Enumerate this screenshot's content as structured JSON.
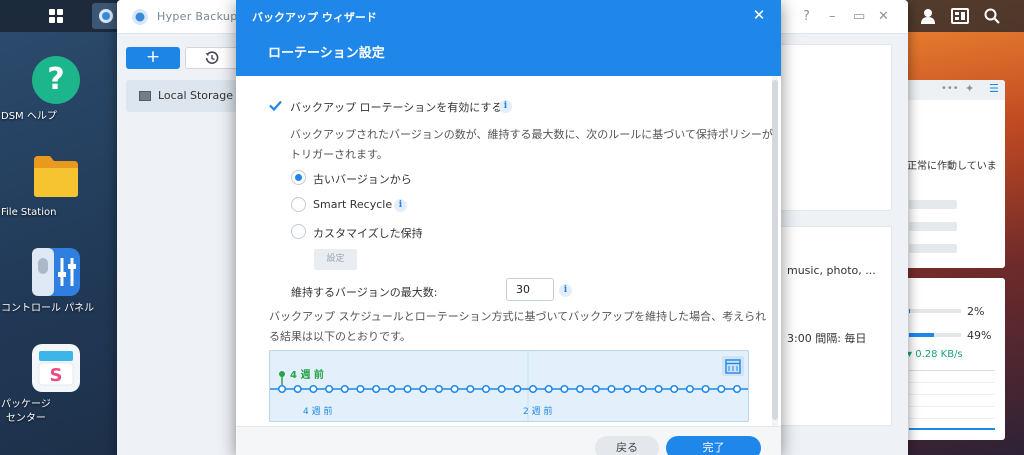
{
  "desktop": {
    "icons": [
      {
        "name": "dsm-help",
        "label": "DSM ヘルプ"
      },
      {
        "name": "file-station",
        "label": "File Station"
      },
      {
        "name": "control-panel",
        "label": "コントロール パネル"
      },
      {
        "name": "package-center",
        "label": "パッケージ\nセンター"
      }
    ]
  },
  "hyper_backup": {
    "title": "Hyper Backup",
    "window_controls": [
      "?",
      "–",
      "▭",
      "✕"
    ],
    "add_label": "+",
    "sidebar_item": "Local Storage",
    "backup_content": "music, photo, ...",
    "schedule_text": "3:00 間隔: 毎日",
    "status_text": "正常に作動していま",
    "progress": [
      {
        "label": "2%",
        "value": 0.02
      },
      {
        "label": "49%",
        "value": 0.49
      }
    ],
    "speed": "0.28 KB/s"
  },
  "wizard": {
    "window_title": "バックアップ ウィザード",
    "heading": "ローテーション設定",
    "enable_rotation_label": "バックアップ ローテーションを有効にする",
    "description_line1": "バックアップされたバージョンの数が、維持する最大数に、次のルールに基づいて保持ポリシーが",
    "description_line2": "トリガーされます。",
    "options": [
      {
        "label": "古いバージョンから",
        "selected": true
      },
      {
        "label": "Smart Recycle",
        "selected": false
      },
      {
        "label": "カスタマイズした保持",
        "selected": false
      }
    ],
    "settings_button": "設定",
    "max_versions_label": "維持するバージョンの最大数:",
    "max_versions_value": "30",
    "result_line1": "バックアップ スケジュールとローテーション方式に基づいてバックアップを維持した場合、考えられ",
    "result_line2": "る結果は以下のとおりです。",
    "timeline": {
      "marker_label": "4 週 前",
      "axis_labels": [
        "4 週 前",
        "2 週 前"
      ],
      "version_count": 30
    },
    "back_button": "戻る",
    "done_button": "完了"
  },
  "colors": {
    "accent": "#1e87e9",
    "marker": "#27a34a"
  }
}
